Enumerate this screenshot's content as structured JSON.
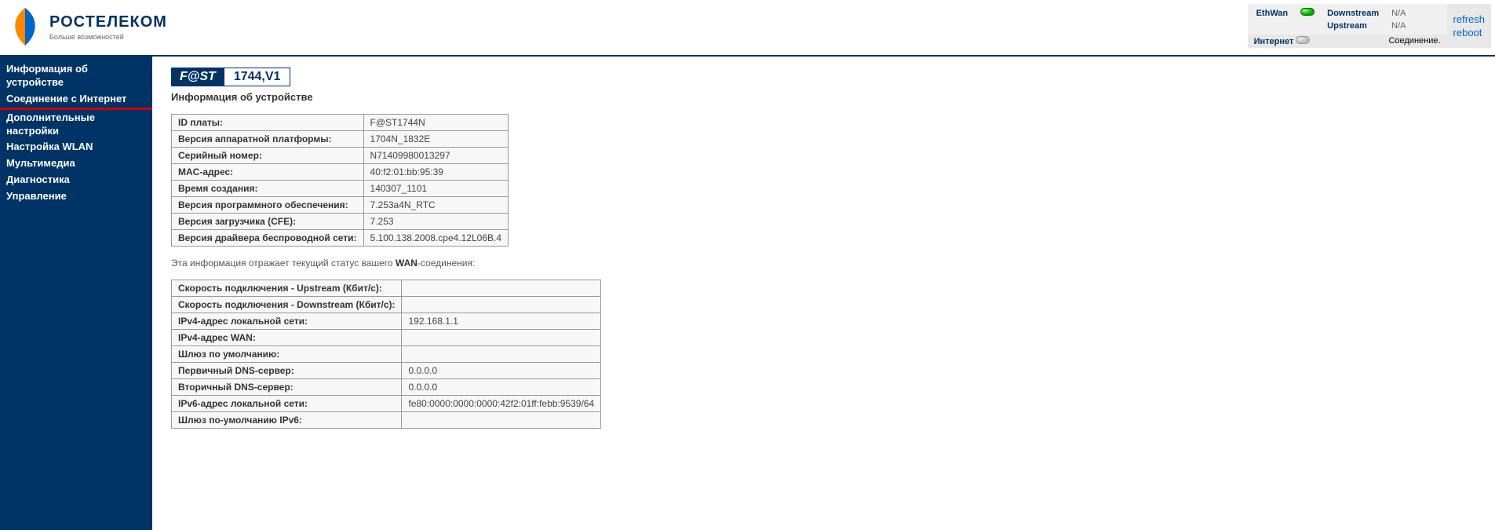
{
  "brand": {
    "name": "РОСТЕЛЕКОМ",
    "tagline": "Больше возможностей"
  },
  "status": {
    "ethwan_label": "EthWan",
    "downstream_label": "Downstream",
    "upstream_label": "Upstream",
    "downstream_value": "N/A",
    "upstream_value": "N/A",
    "internet_label": "Интернет",
    "connection_label": "Соединение.",
    "refresh": "refresh",
    "reboot": "reboot"
  },
  "sidebar": {
    "items": [
      "Информация об устройстве",
      "Соединение с Интернет",
      "Дополнительные настройки",
      "Настройка WLAN",
      "Мультимедиа",
      "Диагностика",
      "Управление"
    ]
  },
  "badge": {
    "left": "F@ST",
    "right": "1744,V1"
  },
  "section_title": "Информация об устройстве",
  "device_info": [
    {
      "label": "ID платы:",
      "value": "F@ST1744N"
    },
    {
      "label": "Версия аппаратной платформы:",
      "value": "1704N_1832E"
    },
    {
      "label": "Серийный номер:",
      "value": "N71409980013297"
    },
    {
      "label": "MAC-адрес:",
      "value": "40:f2:01:bb:95:39"
    },
    {
      "label": "Время создания:",
      "value": "140307_1101"
    },
    {
      "label": "Версия программного обеспечения:",
      "value": "7.253a4N_RTC"
    },
    {
      "label": "Версия загрузчика (CFE):",
      "value": "7.253"
    },
    {
      "label": "Версия драйвера беспроводной сети:",
      "value": "5.100.138.2008.cpe4.12L06B.4"
    }
  ],
  "note_pre": "Эта информация отражает текущий статус вашего ",
  "note_bold": "WAN",
  "note_post": "-соединения:",
  "wan_info": [
    {
      "label": "Скорость подключения - Upstream (Кбит/с):",
      "value": ""
    },
    {
      "label": "Скорость подключения - Downstream (Кбит/с):",
      "value": ""
    },
    {
      "label": "IPv4-адрес локальной сети:",
      "value": "192.168.1.1"
    },
    {
      "label": "IPv4-адрес WAN:",
      "value": ""
    },
    {
      "label": "Шлюз по умолчанию:",
      "value": ""
    },
    {
      "label": "Первичный DNS-сервер:",
      "value": "0.0.0.0"
    },
    {
      "label": "Вторичный DNS-сервер:",
      "value": "0.0.0.0"
    },
    {
      "label": "IPv6-адрес локальной сети:",
      "value": "fe80:0000:0000:0000:42f2:01ff:febb:9539/64"
    },
    {
      "label": "Шлюз по-умолчанию IPv6:",
      "value": ""
    }
  ]
}
